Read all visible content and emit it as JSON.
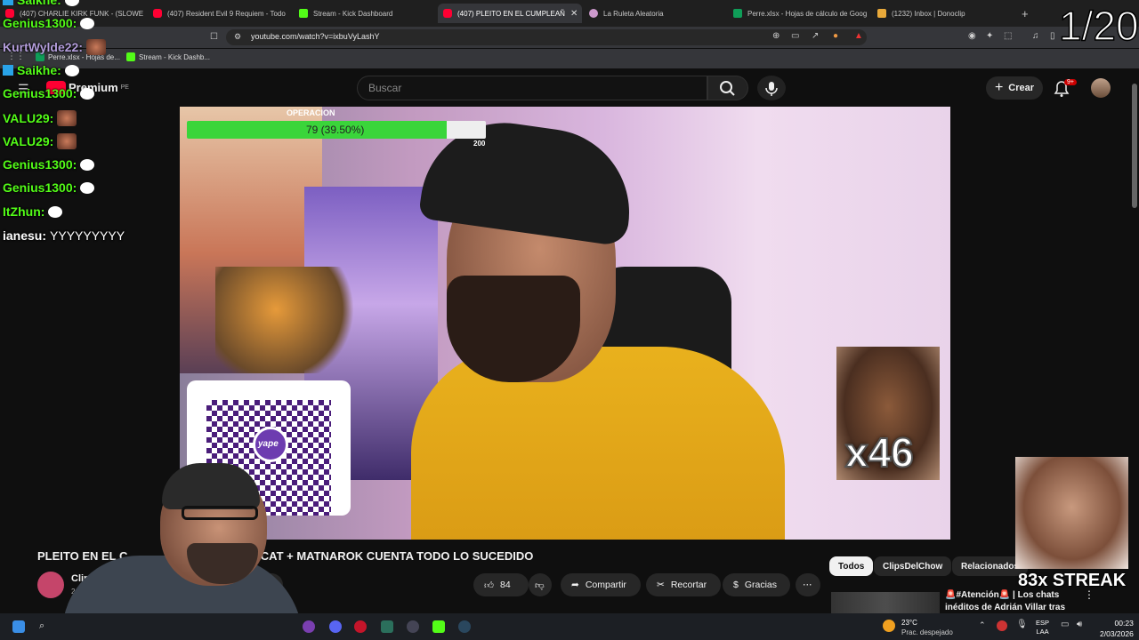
{
  "browser": {
    "tabs": [
      {
        "label": "(407) CHARLIE KIRK FUNK - (SLOWE",
        "icon": "youtube-favicon"
      },
      {
        "label": "(407) Resident Evil 9 Requiem - Todo",
        "icon": "youtube-favicon"
      },
      {
        "label": "Stream - Kick Dashboard",
        "icon": "kick-favicon"
      },
      {
        "label": "(407) PLEITO EN EL CUMPLEAÑ",
        "icon": "youtube-favicon",
        "active": true
      },
      {
        "label": "La Ruleta Aleatoria",
        "icon": "roulette-favicon"
      },
      {
        "label": "Perre.xlsx - Hojas de cálculo de Goog",
        "icon": "sheets-favicon"
      },
      {
        "label": "(1232) Inbox | Donoclip",
        "icon": "mail-favicon"
      }
    ],
    "url": "youtube.com/watch?v=ixbuVyLashY",
    "bookmarks": [
      {
        "label": "Perre.xlsx - Hojas de...",
        "icon": "sheets-favicon"
      },
      {
        "label": "Stream - Kick Dashb...",
        "icon": "kick-favicon"
      }
    ]
  },
  "youtube": {
    "logo_text": "Premium",
    "logo_region": "PE",
    "search_placeholder": "Buscar",
    "create_label": "Crear",
    "notifications_badge": "9+"
  },
  "overlay": {
    "chat": [
      {
        "user": "Saikhe:",
        "color": "#53fc18"
      },
      {
        "user": "Genius1300:",
        "color": "#53fc18"
      },
      {
        "user": "KurtWylde22:",
        "color": "#b39ddb"
      },
      {
        "user": "Saikhe:",
        "color": "#53fc18"
      },
      {
        "user": "Genius1300:",
        "color": "#53fc18"
      },
      {
        "user": "VALU29:",
        "color": "#53fc18"
      },
      {
        "user": "VALU29:",
        "color": "#53fc18"
      },
      {
        "user": "Genius1300:",
        "color": "#53fc18"
      },
      {
        "user": "Genius1300:",
        "color": "#53fc18"
      },
      {
        "user": "ItZhun:",
        "color": "#53fc18"
      },
      {
        "user": "ianesu:",
        "color": "#ffffff",
        "message": "YYYYYYYYY"
      }
    ],
    "counter": "1/20",
    "streak_label": "83x STREAK"
  },
  "video_overlay": {
    "goal_title": "OPERACION",
    "goal_text": "79 (39.50%)",
    "goal_fraction": 0.395,
    "goal_max": "200",
    "qr_label": "yape",
    "meme_count": "x46"
  },
  "video": {
    "title": "PLEITO EN EL C... DE KIMICAT + MATNAROK CUENTA TODO LO SUCEDIDO",
    "title_left": "PLEITO EN EL C",
    "title_right": "S DE KIMICAT + MATNAROK CUENTA TODO LO SUCEDIDO",
    "channel": "ClipsDel",
    "subscribers": "2,4",
    "likes": "84",
    "share_label": "Compartir",
    "clip_label": "Recortar",
    "thanks_label": "Gracias",
    "subscribe_partial": "e"
  },
  "sidebar": {
    "chips": [
      "Todos",
      "ClipsDelChow",
      "Relacionados"
    ],
    "recommendation_title": "🚨#Atención🚨 | Los chats inéditos de Adrián Villar tras el..."
  },
  "taskbar": {
    "weather_temp": "23°C",
    "weather_desc": "Prac. despejado",
    "lang_top": "ESP",
    "lang_bottom": "LAA",
    "time": "00:23",
    "date": "2/03/2026"
  },
  "colors": {
    "youtube_red": "#ff0033",
    "kick_green": "#53fc18",
    "goal_green": "#3ad53a",
    "yape_purple": "#6d3cb0"
  }
}
